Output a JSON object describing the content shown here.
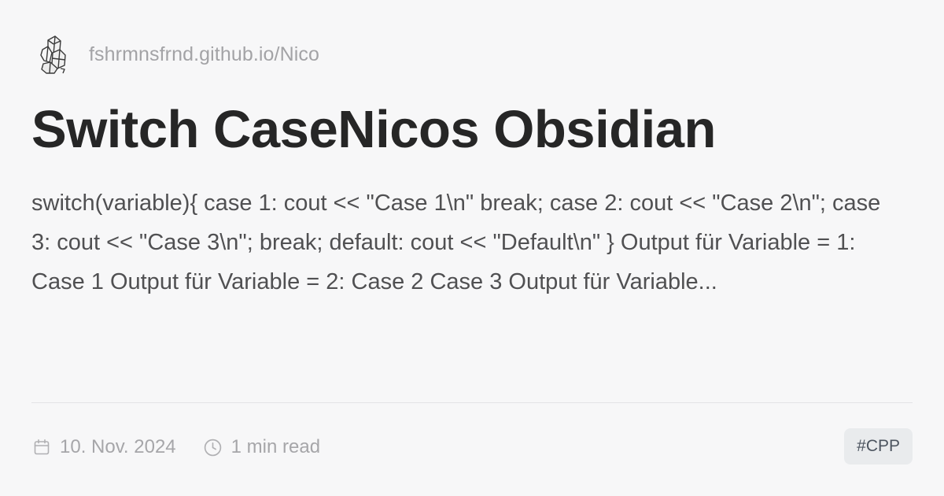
{
  "site": {
    "url": "fshrmnsfrnd.github.io/Nico",
    "logo_icon": "crystal-logo-icon"
  },
  "post": {
    "title": "Switch CaseNicos Obsidian",
    "description": "switch(variable){ case 1: cout << \"Case 1\\n\" break; case 2: cout << \"Case 2\\n\"; case 3: cout << \"Case 3\\n\"; break; default: cout << \"Default\\n\" } Output für Variable = 1: Case 1 Output für Variable = 2: Case 2 Case 3 Output für Variable..."
  },
  "meta": {
    "date": "10. Nov. 2024",
    "date_icon": "calendar-icon",
    "read_time": "1 min read",
    "read_time_icon": "clock-icon"
  },
  "tags": [
    "#CPP"
  ],
  "colors": {
    "background": "#f7f7f8",
    "title": "#262626",
    "body_text": "#505052",
    "muted": "#a6a6a9",
    "tag_bg": "#e9ebed",
    "tag_text": "#4d5560"
  }
}
